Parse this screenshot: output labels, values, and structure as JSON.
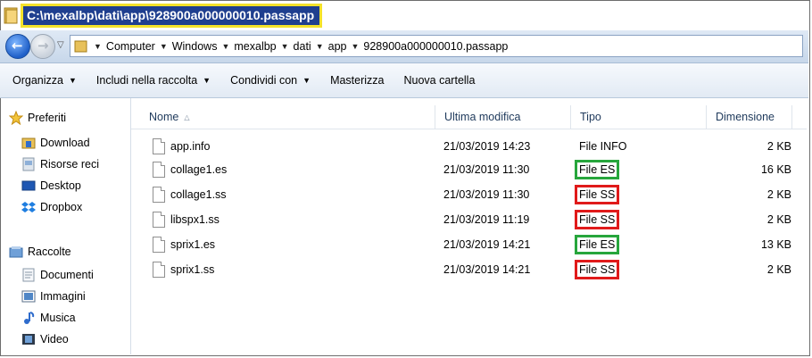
{
  "window": {
    "title": "C:\\mexalbp\\dati\\app\\928900a000000010.passapp"
  },
  "address": {
    "crumbs": [
      "Computer",
      "Windows",
      "mexalbp",
      "dati",
      "app",
      "928900a000000010.passapp"
    ]
  },
  "toolbar": {
    "organize": "Organizza",
    "include": "Includi nella raccolta",
    "share": "Condividi con",
    "burn": "Masterizza",
    "new_folder": "Nuova cartella"
  },
  "nav": {
    "favorites": "Preferiti",
    "download": "Download",
    "recent": "Risorse reci",
    "desktop": "Desktop",
    "dropbox": "Dropbox",
    "libraries": "Raccolte",
    "documents": "Documenti",
    "pictures": "Immagini",
    "music": "Musica",
    "video": "Video"
  },
  "columns": {
    "name": "Nome",
    "modified": "Ultima modifica",
    "type": "Tipo",
    "size": "Dimensione"
  },
  "files": [
    {
      "name": "app.info",
      "modified": "21/03/2019 14:23",
      "type": "File INFO",
      "size": "2 KB",
      "highlight": "none"
    },
    {
      "name": "collage1.es",
      "modified": "21/03/2019 11:30",
      "type": "File ES",
      "size": "16 KB",
      "highlight": "green"
    },
    {
      "name": "collage1.ss",
      "modified": "21/03/2019 11:30",
      "type": "File SS",
      "size": "2 KB",
      "highlight": "red"
    },
    {
      "name": "libspx1.ss",
      "modified": "21/03/2019 11:19",
      "type": "File SS",
      "size": "2 KB",
      "highlight": "red"
    },
    {
      "name": "sprix1.es",
      "modified": "21/03/2019 14:21",
      "type": "File ES",
      "size": "13 KB",
      "highlight": "green"
    },
    {
      "name": "sprix1.ss",
      "modified": "21/03/2019 14:21",
      "type": "File SS",
      "size": "2 KB",
      "highlight": "red"
    }
  ],
  "colors": {
    "title_bg": "#1f3f8f",
    "title_outline": "#f4e22a",
    "es_box": "#27a63c",
    "ss_box": "#e01a1a"
  }
}
